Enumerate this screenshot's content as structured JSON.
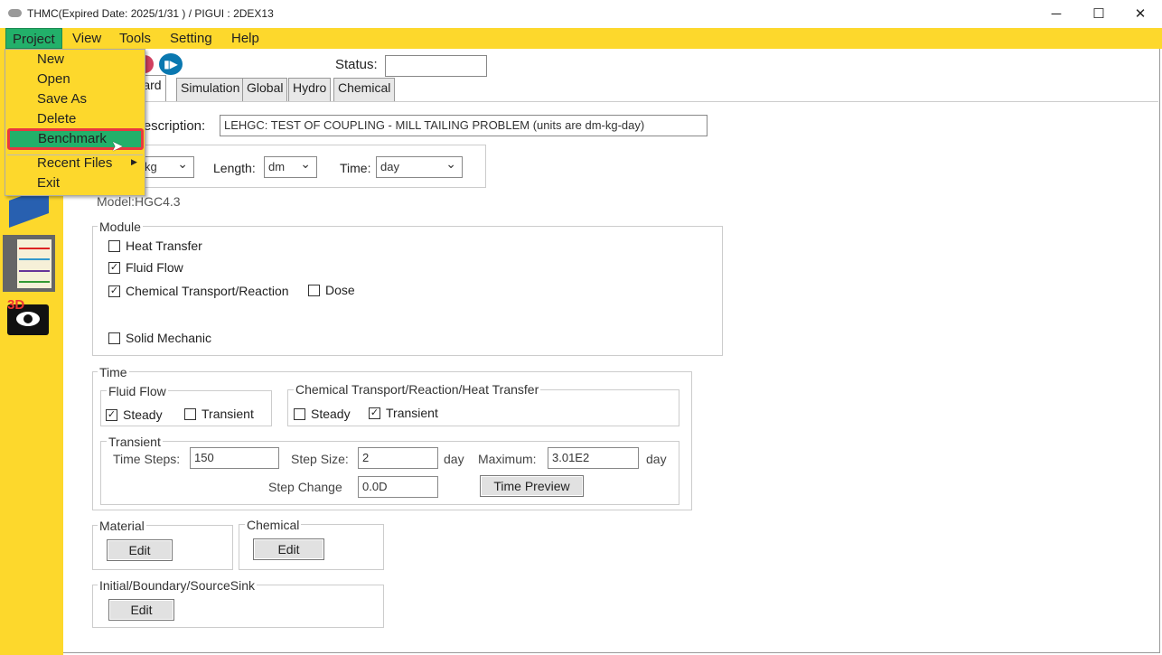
{
  "title": "THMC(Expired Date: 2025/1/31 ) / PIGUI : 2DEX13",
  "window_controls": {
    "minimize": "─",
    "maximize": "☐",
    "close": "✕"
  },
  "menubar": [
    "Project",
    "View",
    "Tools",
    "Setting",
    "Help"
  ],
  "project_menu": {
    "items": [
      "New",
      "Open",
      "Save As",
      "Delete",
      "Benchmark",
      "Recent Files",
      "Exit"
    ],
    "highlighted": "Benchmark",
    "highlight_color": "#22b06a"
  },
  "toolbar": {
    "status_label": "Status:",
    "status_value": ""
  },
  "tabs": [
    "Wizard",
    "Simulation",
    "Global",
    "Hydro",
    "Chemical"
  ],
  "wizard": {
    "description_label": "Description:",
    "description_value": "LEHGC: TEST OF COUPLING - MILL TAILING PROBLEM (units are dm-kg-day)",
    "mass_value": "kg",
    "length_label": "Length:",
    "length_value": "dm",
    "time_label": "Time:",
    "time_value": "day",
    "model": "Model:HGC4.3",
    "module": {
      "title": "Module",
      "heat": "Heat Transfer",
      "heat_checked": false,
      "fluid": "Fluid Flow",
      "fluid_checked": true,
      "chem": "Chemical Transport/Reaction",
      "chem_checked": true,
      "dose": "Dose",
      "dose_checked": false,
      "solid": "Solid Mechanic",
      "solid_checked": false
    },
    "time": {
      "title": "Time",
      "fluid_title": "Fluid Flow",
      "steady": "Steady",
      "transient": "Transient",
      "fluid_steady": true,
      "fluid_transient": false,
      "chem_title": "Chemical Transport/Reaction/Heat Transfer",
      "chem_steady": false,
      "chem_transient": true,
      "transient_title": "Transient",
      "time_steps_label": "Time Steps:",
      "time_steps": "150",
      "step_size_label": "Step Size:",
      "step_size": "2",
      "day": "day",
      "maximum_label": "Maximum:",
      "maximum": "3.01E2",
      "step_change_label": "Step Change",
      "step_change": "0.0D",
      "preview": "Time Preview"
    },
    "material": "Material",
    "chemical": "Chemical",
    "ibs": "Initial/Boundary/SourceSink",
    "edit": "Edit"
  },
  "colors": {
    "yellow": "#fdd82c",
    "green": "#22b06a",
    "red_outline": "#e8393f"
  }
}
